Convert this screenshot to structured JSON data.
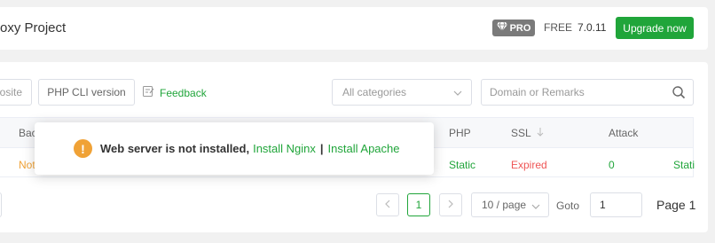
{
  "header": {
    "title": "oxy Project",
    "pro_label": "PRO",
    "free_label": "FREE",
    "version": "7.0.11",
    "upgrade_label": "Upgrade now",
    "accent_color": "#20a53a"
  },
  "toolbar": {
    "site_button": "osite",
    "php_cli_button": "PHP CLI version",
    "feedback_label": "Feedback",
    "category_select": "All categories",
    "search_placeholder": "Domain or Remarks"
  },
  "table": {
    "headers": {
      "backup": "Bac",
      "php": "PHP",
      "ssl": "SSL",
      "attack": "Attack"
    },
    "row": {
      "backup": "Not",
      "php": "Static",
      "ssl": "Expired",
      "attack": "0",
      "extra": "Stati"
    }
  },
  "pagination": {
    "current_page": "1",
    "page_size": "10 / page",
    "goto_label": "Goto",
    "goto_value": "1",
    "page_info": "Page 1"
  },
  "toast": {
    "message": "Web server is not installed,",
    "link_nginx": "Install Nginx",
    "separator": "|",
    "link_apache": "Install Apache"
  }
}
